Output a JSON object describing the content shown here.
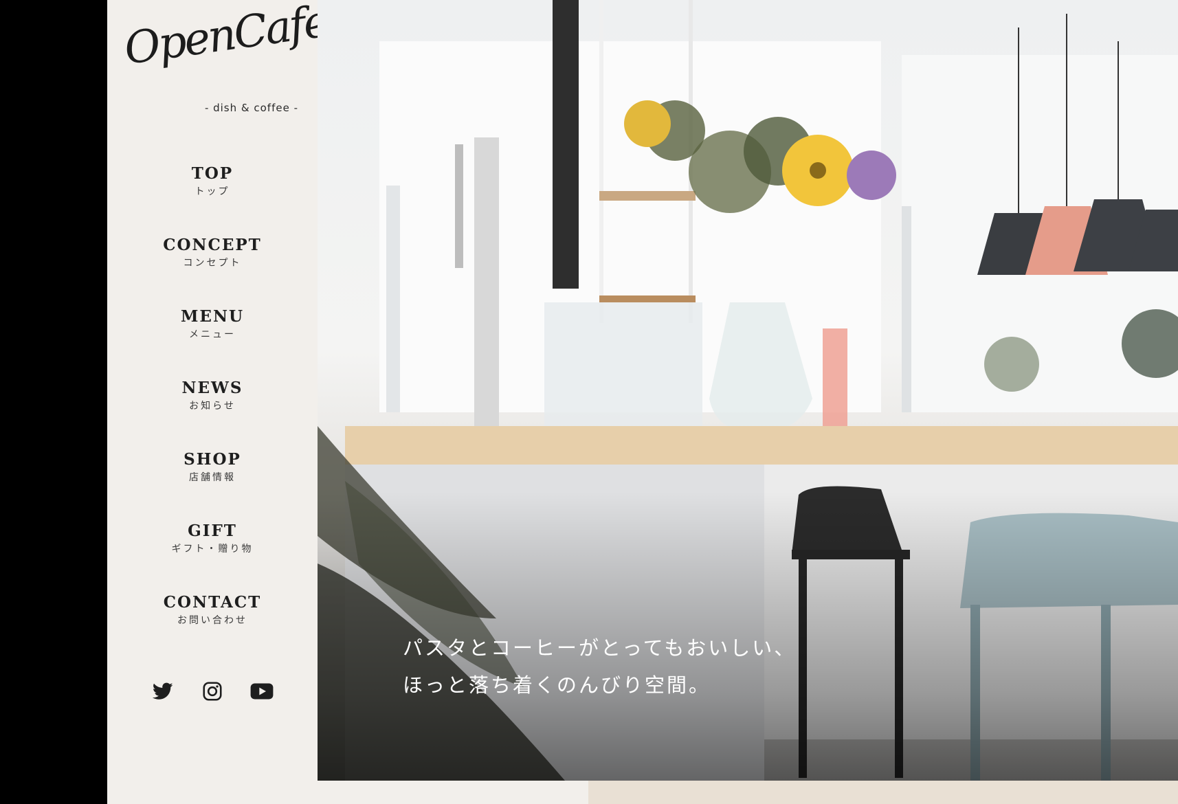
{
  "logo": {
    "script_text": "OpenCafe",
    "tagline": "- dish & coffee -"
  },
  "nav": {
    "items": [
      {
        "en": "TOP",
        "ja": "トップ"
      },
      {
        "en": "CONCEPT",
        "ja": "コンセプト"
      },
      {
        "en": "MENU",
        "ja": "メニュー"
      },
      {
        "en": "NEWS",
        "ja": "お知らせ"
      },
      {
        "en": "SHOP",
        "ja": "店舗情報"
      },
      {
        "en": "GIFT",
        "ja": "ギフト・贈り物"
      },
      {
        "en": "CONTACT",
        "ja": "お問い合わせ"
      }
    ]
  },
  "social": {
    "icons": [
      "twitter-icon",
      "instagram-icon",
      "youtube-icon"
    ]
  },
  "hero": {
    "catch_line1": "パスタとコーヒーがとってもおいしい、",
    "catch_line2": "ほっと落ち着くのんびり空間。"
  },
  "colors": {
    "sidebar_bg": "#f2efeb",
    "text_dark": "#1e1e1e",
    "page_bg": "#000000",
    "bottom_accent": "#e9e0d4"
  }
}
